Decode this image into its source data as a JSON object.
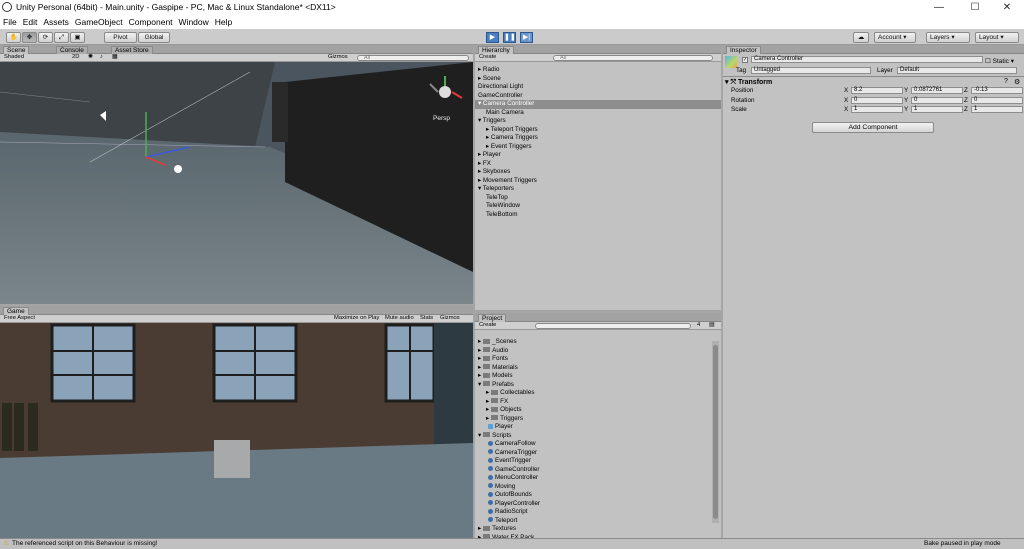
{
  "window": {
    "title": "Unity Personal (64bit) - Main.unity - Gaspipe - PC, Mac & Linux Standalone* <DX11>",
    "minimize": "—",
    "maximize": "☐",
    "close": "✕"
  },
  "menu": [
    "File",
    "Edit",
    "Assets",
    "GameObject",
    "Component",
    "Window",
    "Help"
  ],
  "toolbar": {
    "pivot": "Pivot",
    "global": "Global",
    "play": "▶",
    "pause": "❚❚",
    "step": "▶|",
    "cloud": "☁",
    "account": "Account",
    "layers": "Layers",
    "layout": "Layout"
  },
  "scene": {
    "tab": "Scene",
    "console_tab": "Console",
    "store_tab": "Asset Store",
    "shading": "Shaded",
    "mode_2d": "2D",
    "gizmos": "Gizmos",
    "search": "All",
    "persp": "Persp"
  },
  "game": {
    "tab": "Game",
    "aspect": "Free Aspect",
    "maximize": "Maximize on Play",
    "mute": "Mute audio",
    "stats": "Stats",
    "gizmos": "Gizmos"
  },
  "hierarchy": {
    "tab": "Hierarchy",
    "create": "Create",
    "search": "All",
    "items": [
      {
        "label": "Radio",
        "indent": 0,
        "fold": "closed",
        "selected": false
      },
      {
        "label": "Scene",
        "indent": 0,
        "fold": "closed",
        "selected": false
      },
      {
        "label": "Directional Light",
        "indent": 0,
        "fold": "none",
        "selected": false
      },
      {
        "label": "GameController",
        "indent": 0,
        "fold": "none",
        "selected": false
      },
      {
        "label": "Camera Controller",
        "indent": 0,
        "fold": "open",
        "selected": true
      },
      {
        "label": "Main Camera",
        "indent": 1,
        "fold": "none",
        "selected": false
      },
      {
        "label": "Triggers",
        "indent": 0,
        "fold": "open",
        "selected": false
      },
      {
        "label": "Teleport Triggers",
        "indent": 1,
        "fold": "closed",
        "selected": false
      },
      {
        "label": "Camera Triggers",
        "indent": 1,
        "fold": "closed",
        "selected": false
      },
      {
        "label": "Event Triggers",
        "indent": 1,
        "fold": "closed",
        "selected": false
      },
      {
        "label": "Player",
        "indent": 0,
        "fold": "closed",
        "selected": false
      },
      {
        "label": "FX",
        "indent": 0,
        "fold": "closed",
        "selected": false
      },
      {
        "label": "Skyboxes",
        "indent": 0,
        "fold": "closed",
        "selected": false
      },
      {
        "label": "Movement Triggers",
        "indent": 0,
        "fold": "closed",
        "selected": false
      },
      {
        "label": "Teleporters",
        "indent": 0,
        "fold": "open",
        "selected": false
      },
      {
        "label": "TeleTop",
        "indent": 1,
        "fold": "none",
        "selected": false
      },
      {
        "label": "TeleWindow",
        "indent": 1,
        "fold": "none",
        "selected": false
      },
      {
        "label": "TeleBottom",
        "indent": 1,
        "fold": "none",
        "selected": false
      }
    ]
  },
  "project": {
    "tab": "Project",
    "create": "Create",
    "badge": "4",
    "items": [
      {
        "label": "_Scenes",
        "indent": 0,
        "kind": "folder"
      },
      {
        "label": "Audio",
        "indent": 0,
        "kind": "folder"
      },
      {
        "label": "Fonts",
        "indent": 0,
        "kind": "folder"
      },
      {
        "label": "Materials",
        "indent": 0,
        "kind": "folder"
      },
      {
        "label": "Models",
        "indent": 0,
        "kind": "folder"
      },
      {
        "label": "Prefabs",
        "indent": 0,
        "kind": "folder"
      },
      {
        "label": "Collectables",
        "indent": 1,
        "kind": "folder"
      },
      {
        "label": "FX",
        "indent": 1,
        "kind": "folder"
      },
      {
        "label": "Objects",
        "indent": 1,
        "kind": "folder"
      },
      {
        "label": "Triggers",
        "indent": 1,
        "kind": "folder"
      },
      {
        "label": "Player",
        "indent": 1,
        "kind": "prefab"
      },
      {
        "label": "Scripts",
        "indent": 0,
        "kind": "folder"
      },
      {
        "label": "CameraFollow",
        "indent": 1,
        "kind": "script"
      },
      {
        "label": "CameraTrigger",
        "indent": 1,
        "kind": "script"
      },
      {
        "label": "EventTrigger",
        "indent": 1,
        "kind": "script"
      },
      {
        "label": "GameController",
        "indent": 1,
        "kind": "script"
      },
      {
        "label": "MenuController",
        "indent": 1,
        "kind": "script"
      },
      {
        "label": "Moving",
        "indent": 1,
        "kind": "script"
      },
      {
        "label": "OutofBounds",
        "indent": 1,
        "kind": "script"
      },
      {
        "label": "PlayerController",
        "indent": 1,
        "kind": "script"
      },
      {
        "label": "RadioScript",
        "indent": 1,
        "kind": "script"
      },
      {
        "label": "Teleport",
        "indent": 1,
        "kind": "script"
      },
      {
        "label": "Textures",
        "indent": 0,
        "kind": "folder"
      },
      {
        "label": "Water FX Pack",
        "indent": 0,
        "kind": "folder"
      }
    ]
  },
  "inspector": {
    "tab": "Inspector",
    "object_name": "Camera Controller",
    "static": "Static",
    "tag_label": "Tag",
    "tag": "Untagged",
    "layer_label": "Layer",
    "layer": "Default",
    "component": "Transform",
    "position_label": "Position",
    "position": {
      "x": "8.2",
      "y": "0.0872761",
      "z": "-0.13"
    },
    "rotation_label": "Rotation",
    "rotation": {
      "x": "0",
      "y": "0",
      "z": "0"
    },
    "scale_label": "Scale",
    "scale": {
      "x": "1",
      "y": "1",
      "z": "1"
    },
    "axis_x": "X",
    "axis_y": "Y",
    "axis_z": "Z",
    "add_component": "Add Component"
  },
  "status": {
    "message": "The referenced script on this Behaviour is missing!",
    "bake": "Bake paused in play mode"
  }
}
